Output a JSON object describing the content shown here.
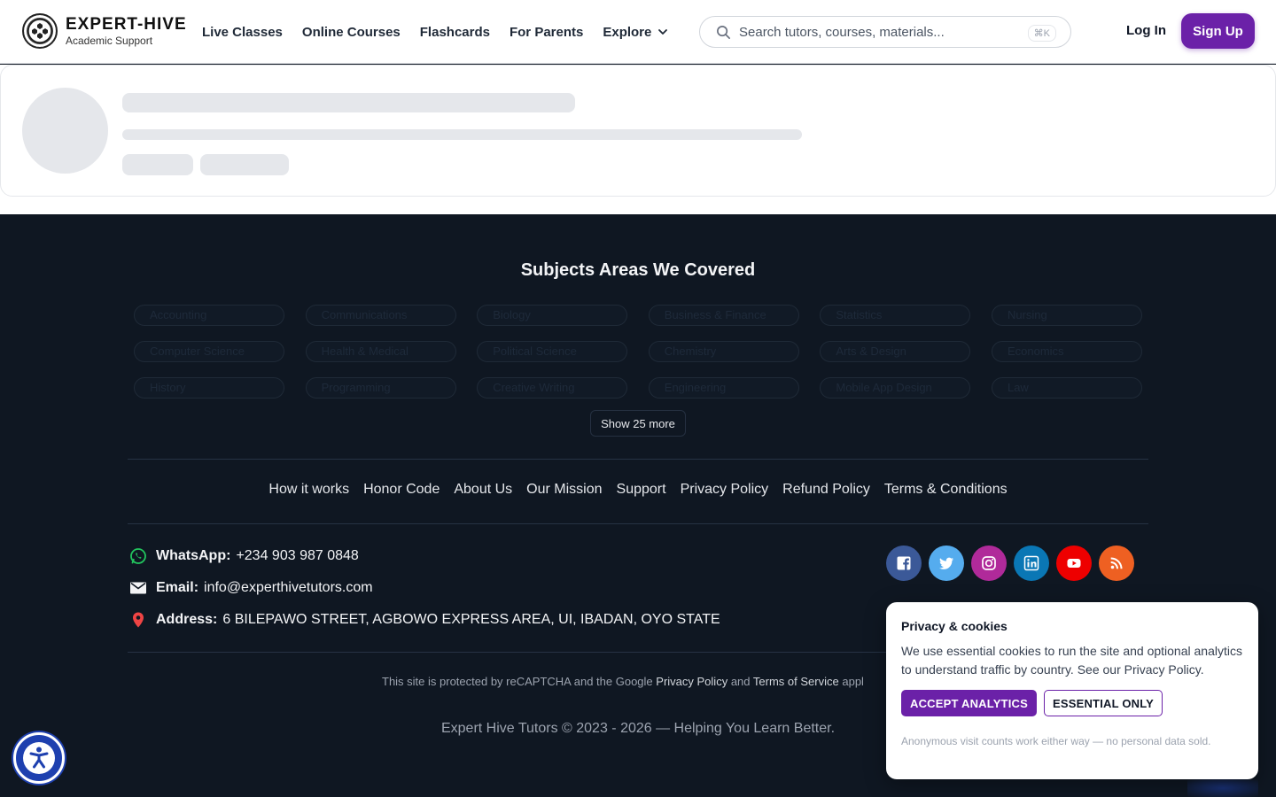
{
  "brand": {
    "title": "EXPERT-HIVE",
    "subtitle": "Academic Support"
  },
  "nav": {
    "items": [
      "Live Classes",
      "Online Courses",
      "Flashcards",
      "For Parents",
      "Explore"
    ]
  },
  "search": {
    "placeholder": "Search tutors, courses, materials...",
    "shortcut": "⌘K"
  },
  "auth": {
    "login": "Log In",
    "signup": "Sign Up"
  },
  "footer": {
    "subjects_title": "Subjects Areas We Covered",
    "subjects": [
      "Accounting",
      "Communications",
      "Biology",
      "Business & Finance",
      "Statistics",
      "Nursing",
      "Computer Science",
      "Health & Medical",
      "Political Science",
      "Chemistry",
      "Arts & Design",
      "Economics",
      "History",
      "Programming",
      "Creative Writing",
      "Engineering",
      "Mobile App Design",
      "Law"
    ],
    "show_more": "Show 25 more",
    "links": [
      "How it works",
      "Honor Code",
      "About Us",
      "Our Mission",
      "Support",
      "Privacy Policy",
      "Refund Policy",
      "Terms & Conditions"
    ],
    "contact": {
      "whatsapp_label": "WhatsApp:",
      "whatsapp_value": "+234 903 987 0848",
      "email_label": "Email:",
      "email_value": "info@experthivetutors.com",
      "address_label": "Address:",
      "address_value": "6 BILEPAWO STREET, AGBOWO EXPRESS AREA, UI, IBADAN, OYO STATE"
    },
    "socials": [
      {
        "name": "facebook",
        "color": "#3b5998"
      },
      {
        "name": "twitter",
        "color": "#55acee"
      },
      {
        "name": "instagram",
        "color": "#b02a9a"
      },
      {
        "name": "linkedin",
        "color": "#0a77b5"
      },
      {
        "name": "youtube",
        "color": "#ee0000"
      },
      {
        "name": "rss",
        "color": "#ee6022"
      }
    ],
    "recaptcha": {
      "prefix": "This site is protected by reCAPTCHA and the Google",
      "privacy": "Privacy Policy",
      "and": "and",
      "terms": "Terms of Service",
      "suffix": "appl"
    },
    "copyright": "Expert Hive Tutors © 2023 - 2026 — Helping You Learn Better."
  },
  "cookie": {
    "title": "Privacy & cookies",
    "text": "We use essential cookies to run the site and optional analytics to understand traffic by country. See our Privacy Policy.",
    "accept": "ACCEPT ANALYTICS",
    "essential": "ESSENTIAL ONLY",
    "note": "Anonymous visit counts work either way — no personal data sold."
  },
  "colors": {
    "accent": "#6b21a8",
    "footer_bg": "#0f1722",
    "a11y": "#1e40af"
  }
}
